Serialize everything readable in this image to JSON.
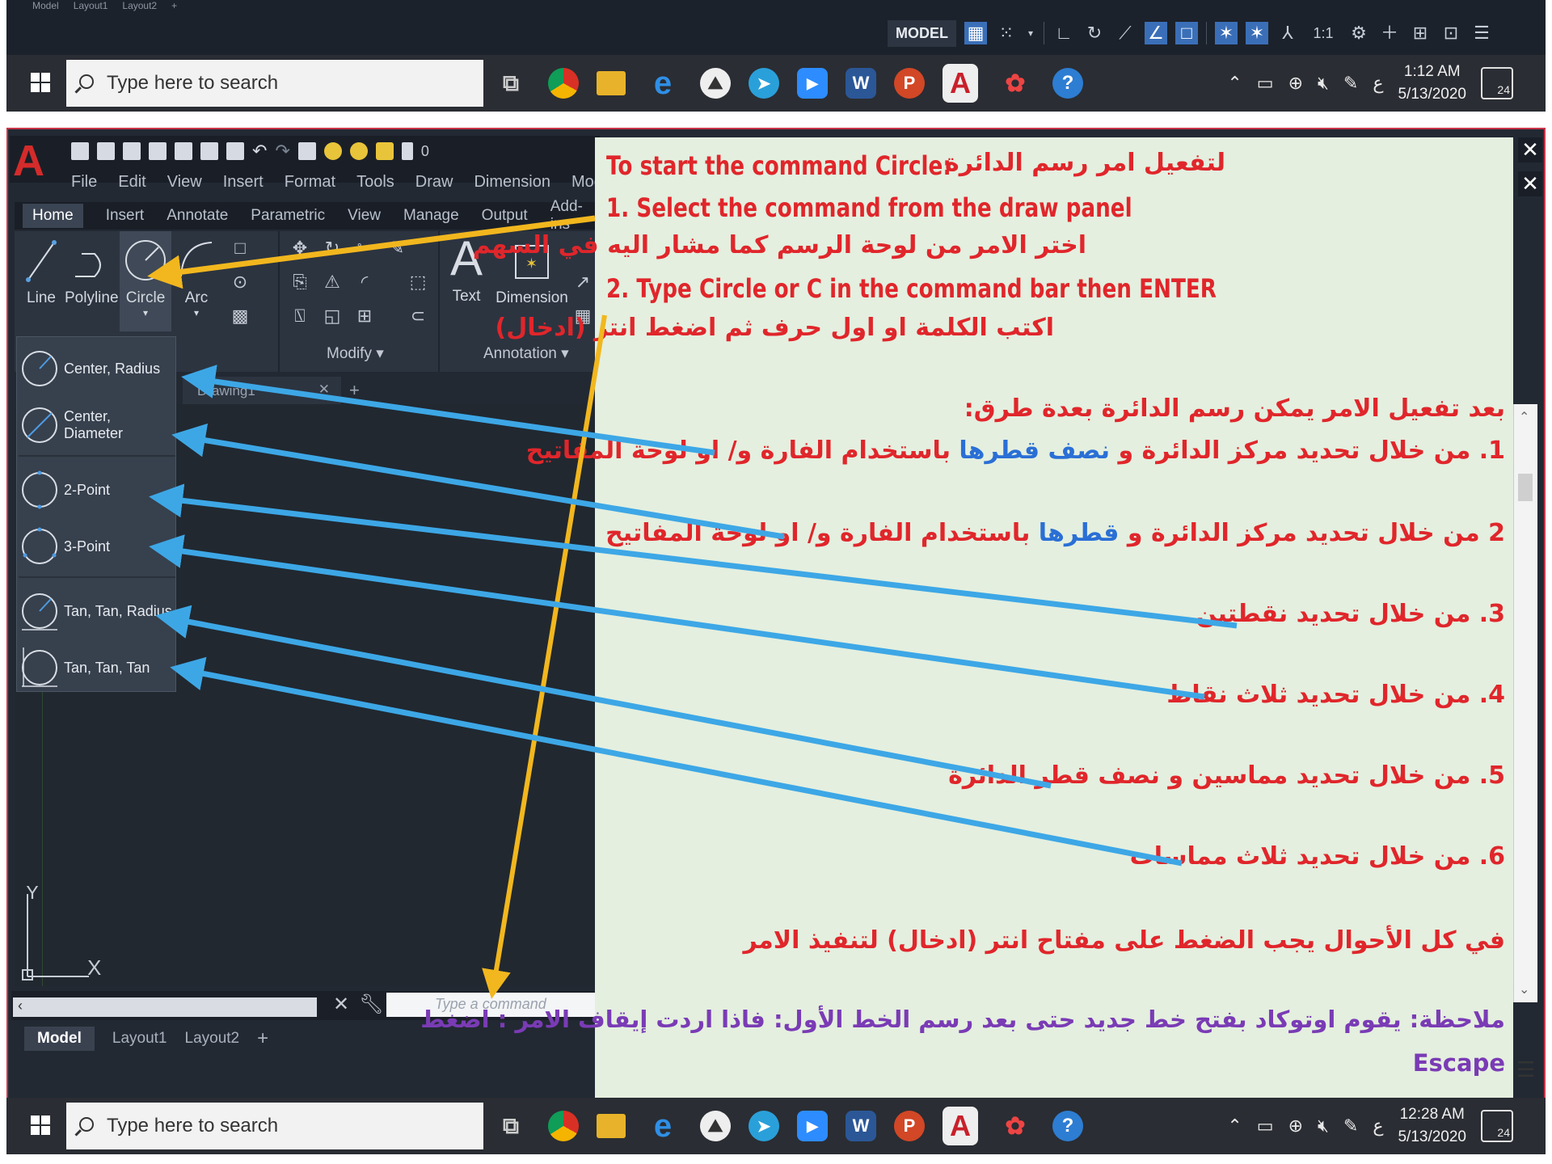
{
  "top_strip": {
    "layout_tabs": [
      "Model",
      "Layout1",
      "Layout2",
      "+"
    ],
    "status_model": "MODEL",
    "scale": "1:1"
  },
  "taskbar_top": {
    "search_placeholder": "Type here to search",
    "time": "1:12 AM",
    "date": "5/13/2020",
    "notifications": "24"
  },
  "acad": {
    "qat_layer": "0",
    "menus": [
      "File",
      "Edit",
      "View",
      "Insert",
      "Format",
      "Tools",
      "Draw",
      "Dimension",
      "Modify"
    ],
    "ribbon_tabs": [
      "Home",
      "Insert",
      "Annotate",
      "Parametric",
      "View",
      "Manage",
      "Output",
      "Add-ins"
    ],
    "draw_tools": [
      "Line",
      "Polyline",
      "Circle",
      "Arc"
    ],
    "annotation_tools": [
      "Text",
      "Dimension"
    ],
    "panels": {
      "modify": "Modify",
      "annotation": "Annotation"
    },
    "file_tab": "Drawing1",
    "circle_options": [
      "Center, Radius",
      "Center, Diameter",
      "2-Point",
      "3-Point",
      "Tan, Tan, Radius",
      "Tan, Tan, Tan"
    ],
    "ucs_y": "Y",
    "ucs_x": "X",
    "command_placeholder": "Type a command",
    "layout_tabs": [
      "Model",
      "Layout1",
      "Layout2",
      "+"
    ]
  },
  "instructions": {
    "title_en": "To start the command Circle:",
    "title_ar": "لتفعيل امر رسم الدائرة",
    "step1_en": "1. Select the command from the draw panel",
    "step1_ar": "اختر الامر من لوحة الرسم كما مشار اليه في السهم",
    "step2_en": "2. Type Circle or C in the command bar then ENTER",
    "step2_ar": "اكتب الكلمة او اول حرف ثم اضغط انتر (ادخال)",
    "methods_intro": "بعد تفعيل الامر يمكن رسم الدائرة بعدة طرق:",
    "method1_a": "1. من خلال تحديد مركز الدائرة و ",
    "method1_blue": "نصف قطرها",
    "method1_b": " باستخدام الفارة و/ او لوحة المفاتيح",
    "method2_a": "2 من خلال تحديد مركز الدائرة و ",
    "method2_blue": "قطرها",
    "method2_b": " باستخدام الفارة و/ او لوحة المفاتيح",
    "method3": "3. من خلال تحديد نقطتين",
    "method4": "4. من خلال تحديد ثلاث نقاط",
    "method5": "5. من خلال تحديد مماسين و نصف قطر الدائرة",
    "method6": "6. من خلال تحديد ثلاث مماسات",
    "enter_note": "في كل الأحوال يجب الضغط على مفتاح انتر (ادخال) لتنفيذ الامر",
    "note": "ملاحظة: يقوم اوتوكاد بفتح خط جديد حتى بعد رسم الخط الأول: فاذا اردت إيقاف الامر : اضغط",
    "escape": "Escape"
  },
  "taskbar_bottom": {
    "search_placeholder": "Type here to search",
    "time": "12:28 AM",
    "date": "5/13/2020",
    "notifications": "24"
  },
  "colors": {
    "instruction_red": "#e0262b",
    "highlight_blue": "#2a6fd6",
    "note_purple": "#7a3bb5",
    "panel_bg": "#e4efdf",
    "arrow_blue": "#3da7e6",
    "arrow_yellow": "#f2b71e",
    "acad_red": "#d42b2b"
  }
}
